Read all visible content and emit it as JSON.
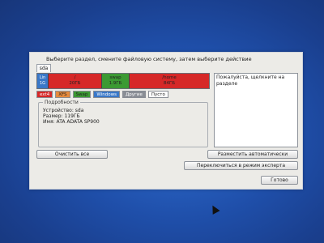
{
  "dialog": {
    "instruction": "Выберите раздел, смените файловую систему, затем выберите действие"
  },
  "disk": {
    "tab_label": "sda",
    "partitions": [
      {
        "line1": "Lin",
        "line2": "1G",
        "color": "#3a78c8"
      },
      {
        "line1": "/",
        "line2": "20ГБ",
        "color": "#d62828"
      },
      {
        "line1": "swap",
        "line2": "1.9ГБ",
        "color": "#3c9a33"
      },
      {
        "line1": "/home",
        "line2": "84ГБ",
        "color": "#d62828"
      }
    ]
  },
  "legend": [
    {
      "label": "ext4",
      "color": "#d62828",
      "text_color": "#ffffff"
    },
    {
      "label": "XFS",
      "color": "#e58a3c",
      "text_color": "#222222"
    },
    {
      "label": "Swap",
      "color": "#3c9a33",
      "text_color": "#222222"
    },
    {
      "label": "Windows",
      "color": "#3a78c8",
      "text_color": "#ffffff"
    },
    {
      "label": "Другие",
      "color": "#8a8e95",
      "text_color": "#ffffff"
    },
    {
      "label": "Пусто",
      "color": "#ffffff",
      "text_color": "#222222"
    }
  ],
  "side_panel": {
    "text": "Пожалуйста, щелкните на разделе"
  },
  "details": {
    "title": "Подробности",
    "device": "Устройство: sda",
    "size": "Размер: 119ГБ",
    "name": "Имя: ATA ADATA SP900"
  },
  "buttons": {
    "clear_all": "Очистить все",
    "auto_allocate": "Разместить автоматически",
    "expert_mode": "Переключиться в режим эксперта",
    "done": "Готово"
  }
}
